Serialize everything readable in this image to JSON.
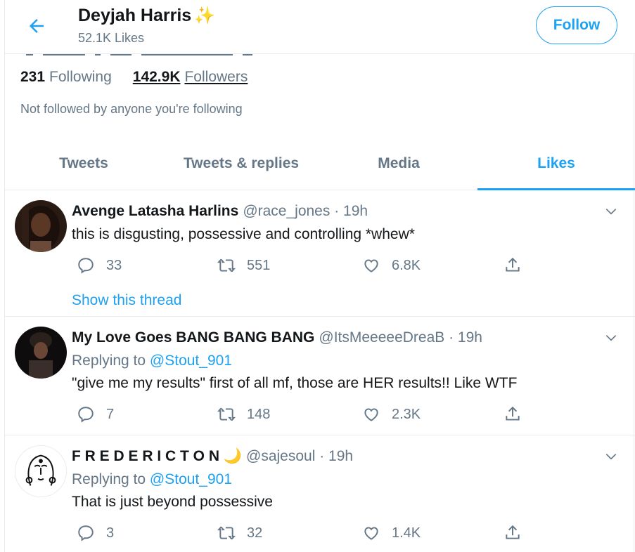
{
  "header": {
    "name": "Deyjah Harris",
    "emoji": "✨",
    "likes_count": "52.1K Likes",
    "follow_label": "Follow"
  },
  "profile": {
    "following_count": "231",
    "following_label": "Following",
    "followers_count": "142.9K",
    "followers_label": "Followers",
    "not_followed": "Not followed by anyone you're following"
  },
  "tabs": [
    {
      "label": "Tweets",
      "active": false
    },
    {
      "label": "Tweets & replies",
      "active": false
    },
    {
      "label": "Media",
      "active": false
    },
    {
      "label": "Likes",
      "active": true
    }
  ],
  "tweets": [
    {
      "name": "Avenge Latasha Harlins",
      "handle": "@race_jones · 19h",
      "replying_prefix": "",
      "replying_to": "",
      "text": "this is disgusting, possessive and controlling *whew*",
      "replies": "33",
      "retweets": "551",
      "likes": "6.8K",
      "show_thread": "Show this thread"
    },
    {
      "name": "My Love Goes BANG BANG BANG",
      "handle": "@ItsMeeeeeDreaB · 19h",
      "replying_prefix": "Replying to",
      "replying_to": "@Stout_901",
      "text": "\"give me my results\" first of all mf, those are HER results!! Like WTF",
      "replies": "7",
      "retweets": "148",
      "likes": "2.3K",
      "show_thread": ""
    },
    {
      "name": "F R E D E R I C T O N",
      "name_emoji": "🌙",
      "handle": "@sajesoul · 19h",
      "replying_prefix": "Replying to",
      "replying_to": "@Stout_901",
      "text": "That is just beyond possessive",
      "replies": "3",
      "retweets": "32",
      "likes": "1.4K",
      "show_thread": ""
    }
  ],
  "colors": {
    "accent": "#1da1f2",
    "secondary_text": "#657786",
    "border": "#e6ecf0"
  },
  "icons": [
    "back-arrow-icon",
    "chevron-down-icon",
    "reply-icon",
    "retweet-icon",
    "like-icon",
    "share-icon",
    "sparkles-icon",
    "moon-icon"
  ]
}
